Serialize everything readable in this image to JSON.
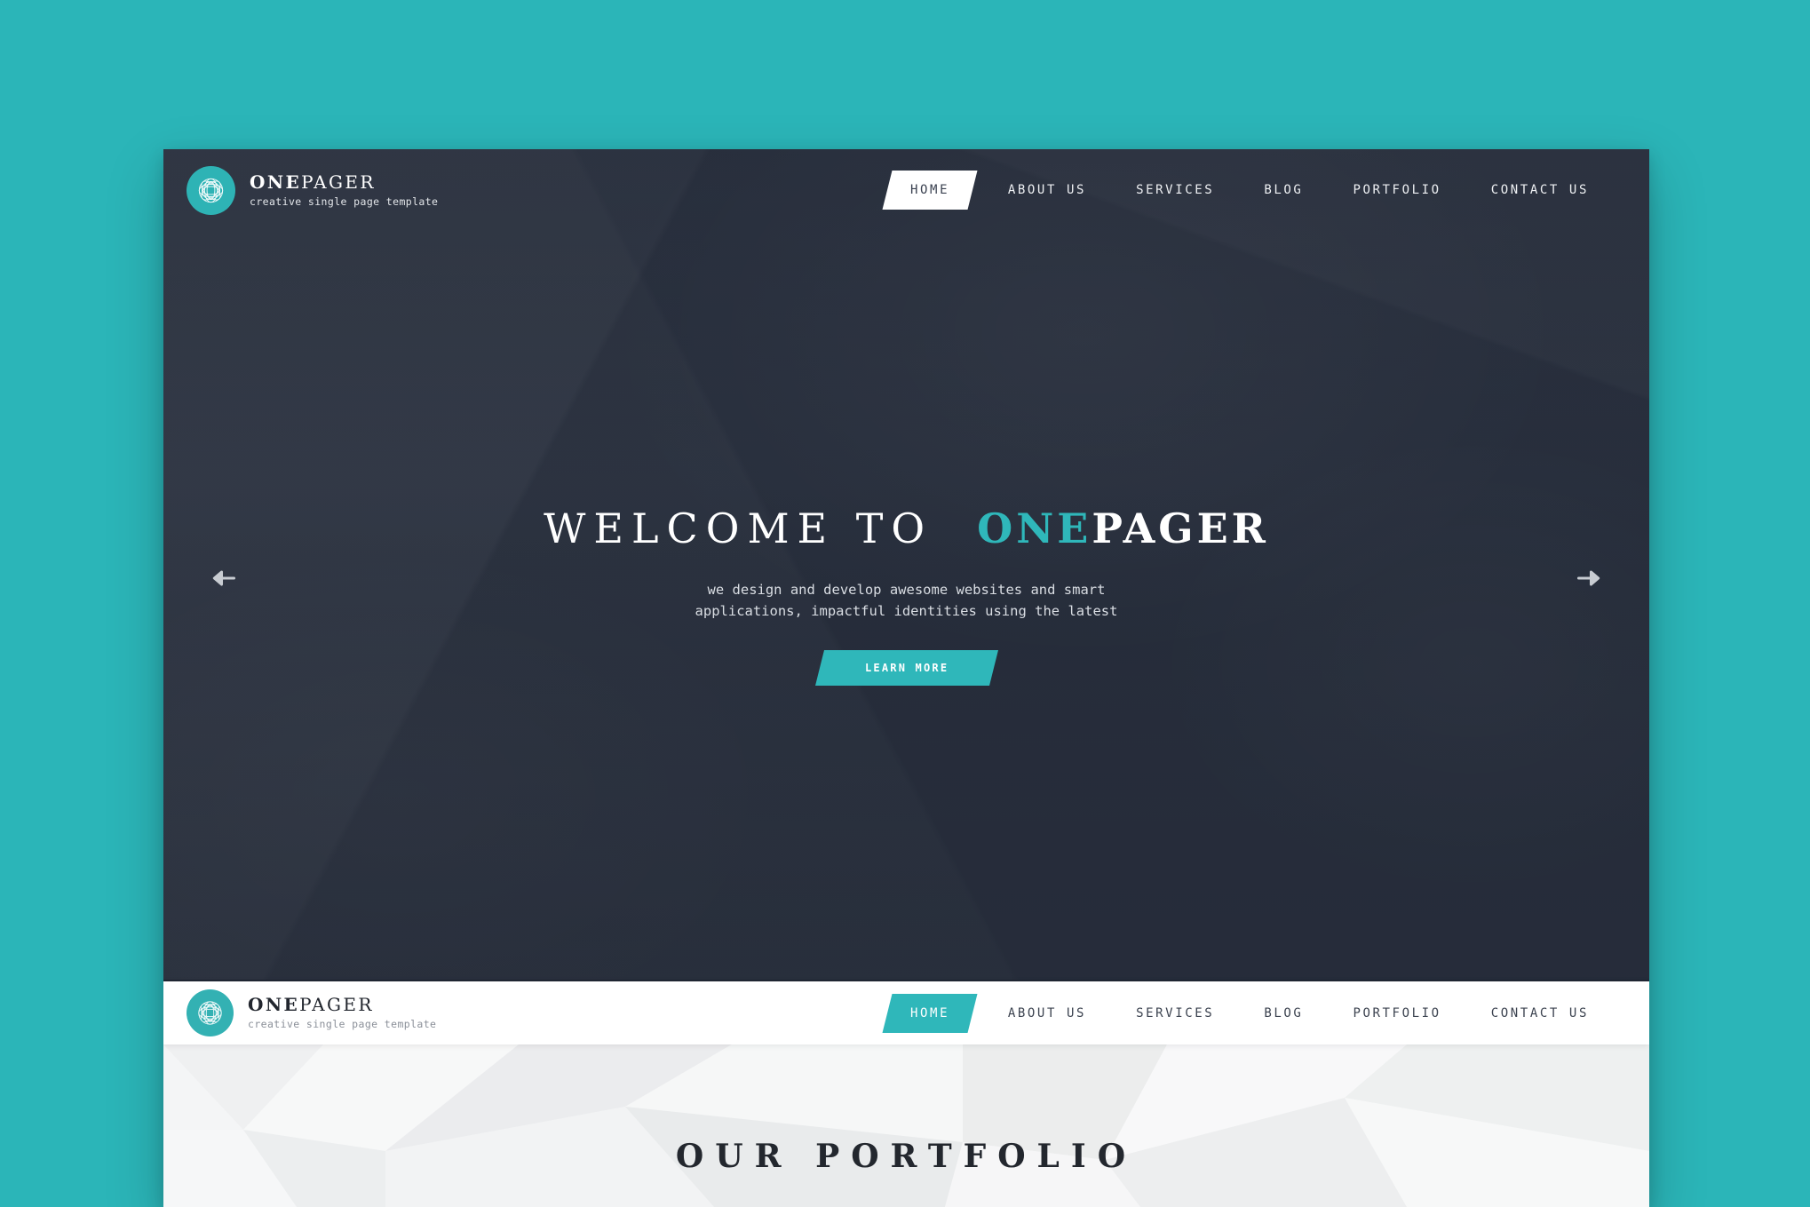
{
  "theme": {
    "page_background": "#2bb5b8",
    "accent": "#2fb7ba",
    "dark": "#2a3140",
    "light_panel": "#ffffff",
    "section_background": "#f3f4f5"
  },
  "brand": {
    "name_bold": "ONE",
    "name_light": "PAGER",
    "tagline": "creative single page template",
    "mark_icon": "geometric-flower-logo-icon"
  },
  "nav": {
    "items": [
      {
        "label": "HOME",
        "active": true
      },
      {
        "label": "ABOUT US",
        "active": false
      },
      {
        "label": "SERVICES",
        "active": false
      },
      {
        "label": "BLOG",
        "active": false
      },
      {
        "label": "PORTFOLIO",
        "active": false
      },
      {
        "label": "CONTACT US",
        "active": false
      }
    ]
  },
  "hero": {
    "title_light": "WELCOME TO",
    "title_accent": "ONE",
    "title_strong": "PAGER",
    "subtitle": "we design and develop awesome websites and smart applications, impactful identities using the latest",
    "cta_label": "LEARN MORE",
    "prev_icon": "arrow-left-icon",
    "next_icon": "arrow-right-icon"
  },
  "portfolio": {
    "title": "OUR PORTFOLIO"
  }
}
